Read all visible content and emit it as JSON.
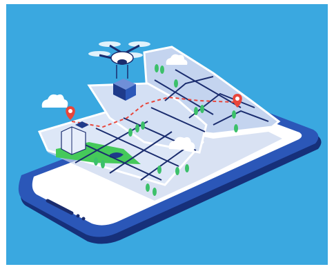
{
  "illustration": {
    "subject": "",
    "colors": {
      "background": "#3aa8e0",
      "phone_body": "#1e3a8a",
      "phone_edge": "#2b57b8",
      "screen": "#ffffff",
      "map_light": "#dde7f7",
      "map_mid": "#c4d4ef",
      "street": "#1a2c6e",
      "grass": "#45c95a",
      "tree": "#3cc06a",
      "route": "#e8463b",
      "pin": "#e8463b",
      "cloud": "#ffffff"
    }
  }
}
